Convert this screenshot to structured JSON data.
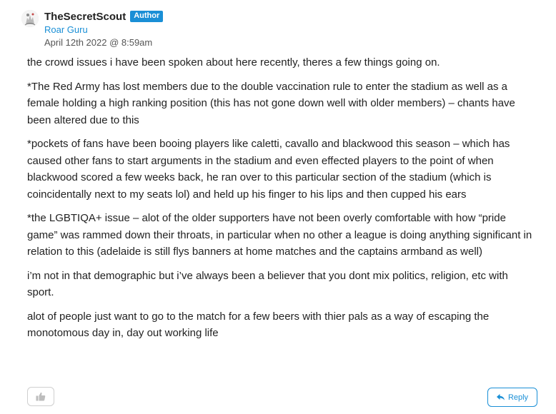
{
  "author": {
    "username": "TheSecretScout",
    "badge": "Author",
    "role": "Roar Guru",
    "date": "April 12th 2022 @ 8:59am",
    "avatar_icon": "avatar-icon"
  },
  "post": {
    "paragraphs": [
      "the crowd issues i have been spoken about here recently, theres a few things going on.",
      "*The Red Army has lost members due to the double vaccination rule to enter the stadium as well as a female holding a high ranking position (this has not gone down well with older members) – chants have been altered due to this",
      "*pockets of fans have been booing players like caletti, cavallo and blackwood this season – which has caused other fans to start arguments in the stadium and even effected players to the point of when blackwood scored a few weeks back, he ran over to this particular section of the stadium (which is coincidentally next to my seats lol) and held up his finger to his lips and then cupped his ears",
      "*the LGBTIQA+ issue – alot of the older supporters have not been overly comfortable with how “pride game” was rammed down their throats, in particular when no other a league is doing anything significant in relation to this (adelaide is still flys banners at home matches and the captains armband as well)",
      "i’m not in that demographic but i’ve always been a believer that you dont mix politics, religion, etc with sport.",
      "alot of people just want to go to the match for a few beers with thier pals as a way of escaping the monotomous day in, day out working life"
    ]
  },
  "actions": {
    "like_icon": "thumbs-up-icon",
    "reply_icon": "reply-arrow-icon",
    "reply_label": "Reply"
  },
  "colors": {
    "accent": "#1a8fd6",
    "text": "#222222",
    "muted": "#555555"
  }
}
